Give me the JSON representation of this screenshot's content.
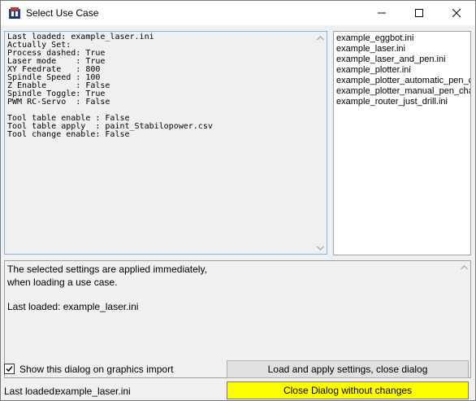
{
  "window": {
    "title": "Select Use Case",
    "icon": "inkscape-app-icon"
  },
  "settings_text": {
    "lines": [
      "Last loaded: example_laser.ini",
      "Actually Set:",
      "Process dashed: True",
      "Laser mode    : True",
      "XY Feedrate   : 800",
      "Spindle Speed : 100",
      "Z Enable      : False",
      "Spindle Toggle: True",
      "PWM RC-Servo  : False",
      "",
      "Tool table enable : False",
      "Tool table apply  : paint_Stabilopower.csv",
      "Tool change enable: False"
    ]
  },
  "use_case_list": {
    "items": [
      "example_eggbot.ini",
      "example_laser.ini",
      "example_laser_and_pen.ini",
      "example_plotter.ini",
      "example_plotter_automatic_pen_change.ini",
      "example_plotter_manual_pen_change.ini",
      "example_router_just_drill.ini"
    ]
  },
  "info_text": {
    "lines": [
      "The selected settings are applied immediately,",
      "when loading a use case.",
      "",
      "Last loaded: example_laser.ini"
    ]
  },
  "footer": {
    "checkbox_label": "Show this dialog on graphics import",
    "checkbox_checked": true,
    "load_button_label": "Load and apply settings, close dialog",
    "close_button_label": "Close Dialog without changes",
    "close_button_color": "#ffff00",
    "status_label": "Last loaded:",
    "status_value": "example_laser.ini"
  }
}
